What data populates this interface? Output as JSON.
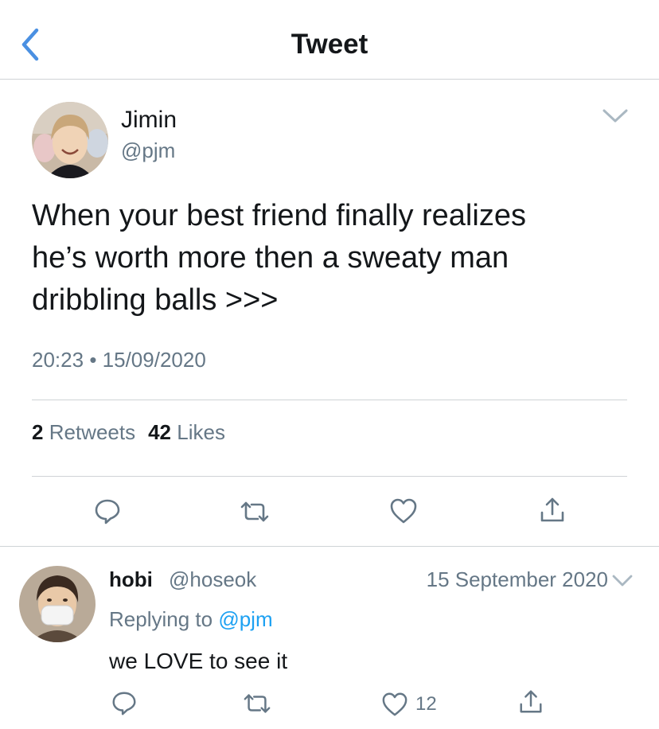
{
  "header": {
    "title": "Tweet",
    "back_icon": "chevron-left-icon"
  },
  "tweet": {
    "author_name": "Jimin",
    "author_handle": "@pjm",
    "text_lines": [
      "When your best friend finally realizes",
      "he’s worth more then a sweaty man",
      "dribbling balls >>>"
    ],
    "time": "20:23",
    "separator": "•",
    "date": "15/09/2020",
    "retweet_count": "2",
    "retweet_label": "Retweets",
    "like_count": "42",
    "like_label": "Likes"
  },
  "reply": {
    "author_name": "hobi",
    "author_handle": "@hoseok",
    "date": "15 September 2020",
    "replying_prefix": "Replying to",
    "replying_handle": "@pjm",
    "text": "we LOVE to see it",
    "like_count": "12"
  },
  "colors": {
    "accent": "#1da1f2",
    "back_icon": "#4a90e2",
    "secondary_text": "#657786",
    "icon_gray": "#657786",
    "divider": "#cfd3d6"
  }
}
